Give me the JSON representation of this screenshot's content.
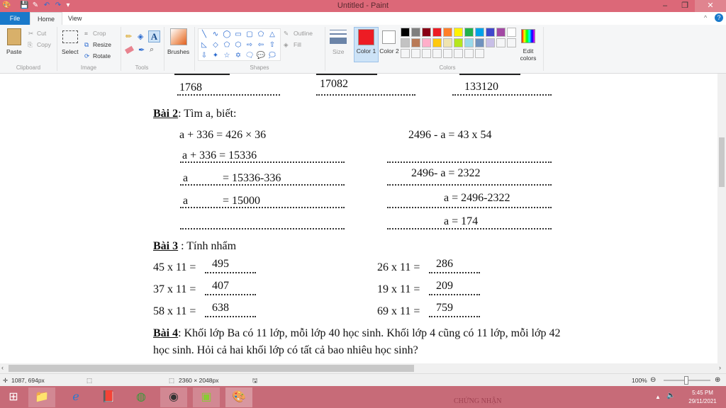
{
  "window": {
    "title": "Untitled - Paint",
    "minimize": "–",
    "restore": "❐",
    "close": "✕"
  },
  "quick_access": {
    "save": "💾",
    "undo": "↶",
    "redo": "↷",
    "customize": "▾"
  },
  "tabs": [
    {
      "label": "File"
    },
    {
      "label": "Home"
    },
    {
      "label": "View"
    }
  ],
  "ribbon": {
    "clipboard": {
      "group": "Clipboard",
      "paste": "Paste",
      "cut": "Cut",
      "copy": "Copy"
    },
    "image": {
      "group": "Image",
      "select": "Select",
      "crop": "Crop",
      "resize": "Resize",
      "rotate": "Rotate"
    },
    "tools": {
      "group": "Tools"
    },
    "brushes": "Brushes",
    "shapes": {
      "group": "Shapes",
      "outline": "Outline",
      "fill": "Fill",
      "glyphs": [
        "╲",
        "∿",
        "◯",
        "▭",
        "▢",
        "⬠",
        "△",
        "◺",
        "◇",
        "⬠",
        "⬡",
        "⇨",
        "⇦",
        "⇧",
        "⇩",
        "✦",
        "☆",
        "✡",
        "🗨",
        "💬",
        "🗯"
      ]
    },
    "size": "Size",
    "colors": {
      "group": "Colors",
      "color1": "Color 1",
      "color2": "Color 2",
      "edit": "Edit colors",
      "color1_value": "#ed1c24",
      "color2_value": "#ffffff",
      "palette": [
        "#000000",
        "#7f7f7f",
        "#880015",
        "#ed1c24",
        "#ff7f27",
        "#fff200",
        "#22b14c",
        "#00a2e8",
        "#3f48cc",
        "#a349a4",
        "#ffffff",
        "#c3c3c3",
        "#b97a57",
        "#ffaec9",
        "#ffc90e",
        "#efe4b0",
        "#b5e61d",
        "#99d9ea",
        "#7092be",
        "#c8bfe7"
      ]
    }
  },
  "document": {
    "top_results": [
      "1768",
      "17082",
      "133120"
    ],
    "bai2": {
      "label": "Bài 2",
      "text": ": Tìm a, biết:",
      "left": [
        "a + 336 = 426 × 36",
        "a + 336 = 15336",
        "a",
        "= 15336-336",
        "a",
        "= 15000"
      ],
      "right": [
        "2496 - a  = 43 x 54",
        "2496- a = 2322",
        "a = 2496-2322",
        "a = 174"
      ]
    },
    "bai3": {
      "label": "Bài 3",
      "text": " : Tính nhẩm",
      "items": [
        {
          "expr": "45 x 11 = ",
          "ans": "495"
        },
        {
          "expr": "26 x 11 = ",
          "ans": "286"
        },
        {
          "expr": "37 x 11 = ",
          "ans": "407"
        },
        {
          "expr": "19 x 11 = ",
          "ans": "209"
        },
        {
          "expr": "58 x 11 = ",
          "ans": "638"
        },
        {
          "expr": "69 x 11 = ",
          "ans": "759"
        }
      ]
    },
    "bai4": {
      "label": "Bài 4",
      "line1": ": Khối lớp Ba có 11 lớp, mỗi lớp 40 học sinh. Khối lớp 4 cũng có 11 lớp, mỗi lớp 42",
      "line2": "học sinh. Hỏi cả hai khối lớp có tất cả bao nhiêu học sinh?"
    }
  },
  "status": {
    "cursor": "1087, 694px",
    "size": "2360 × 2048px",
    "zoom": "100%"
  },
  "taskbar": {
    "time": "5:45 PM",
    "date": "29/11/2021",
    "wallpaper_text": "CHỨNG NHẬN"
  }
}
